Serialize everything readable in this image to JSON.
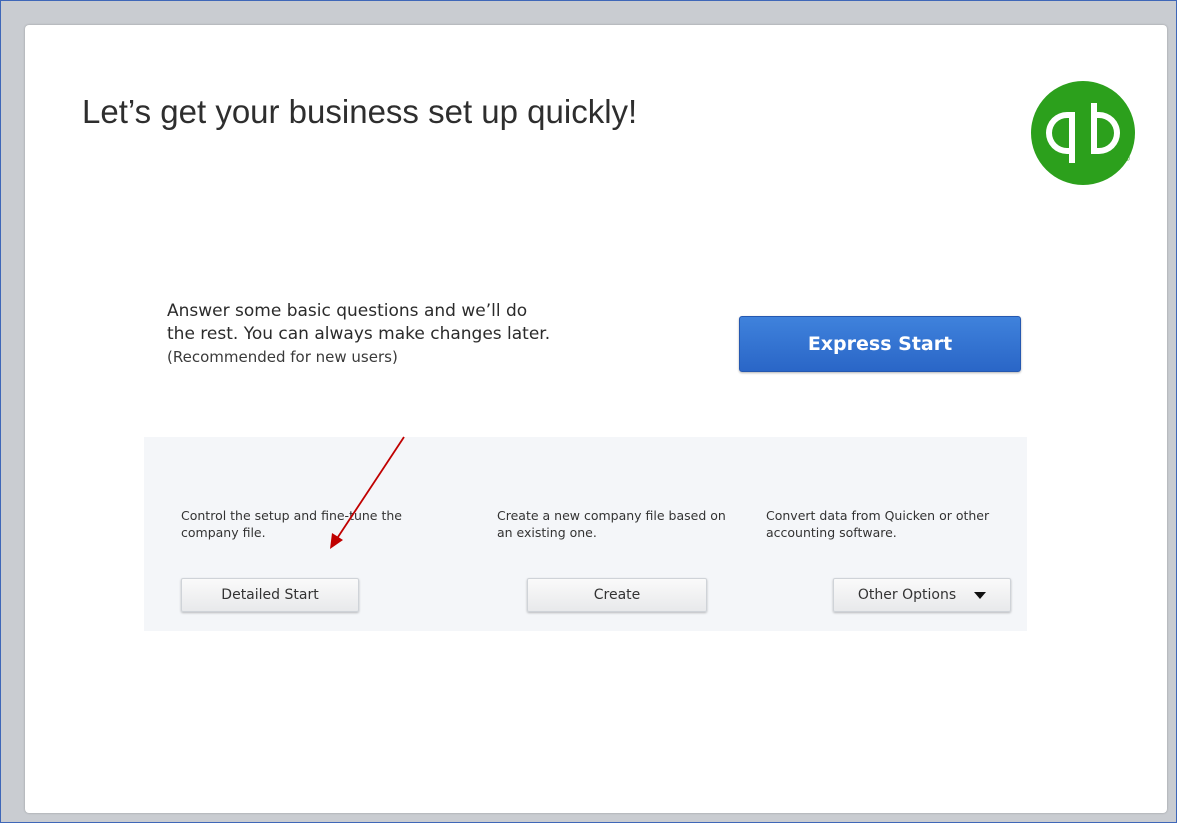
{
  "headline": "Let’s get your business set up quickly!",
  "brand": {
    "logo_icon": "quickbooks-logo-icon",
    "logo_color": "#2ca01c",
    "registered_mark": "®"
  },
  "express": {
    "lines": [
      "Answer some basic questions and we’ll do",
      "the rest. You can always make changes later."
    ],
    "note": "(Recommended for new users)",
    "button_label": "Express Start",
    "button_color": "#2f6fd1"
  },
  "options": [
    {
      "description": "Control the setup and fine-tune the company file.",
      "button_label": "Detailed Start"
    },
    {
      "description": "Create a new company file based on an existing one.",
      "button_label": "Create"
    },
    {
      "description": "Convert data from Quicken or other accounting software.",
      "button_label": "Other Options",
      "button_icon": "dropdown-arrow-icon"
    }
  ],
  "annotation": {
    "icon": "red-arrow-annotation-icon",
    "color": "#c00000"
  }
}
